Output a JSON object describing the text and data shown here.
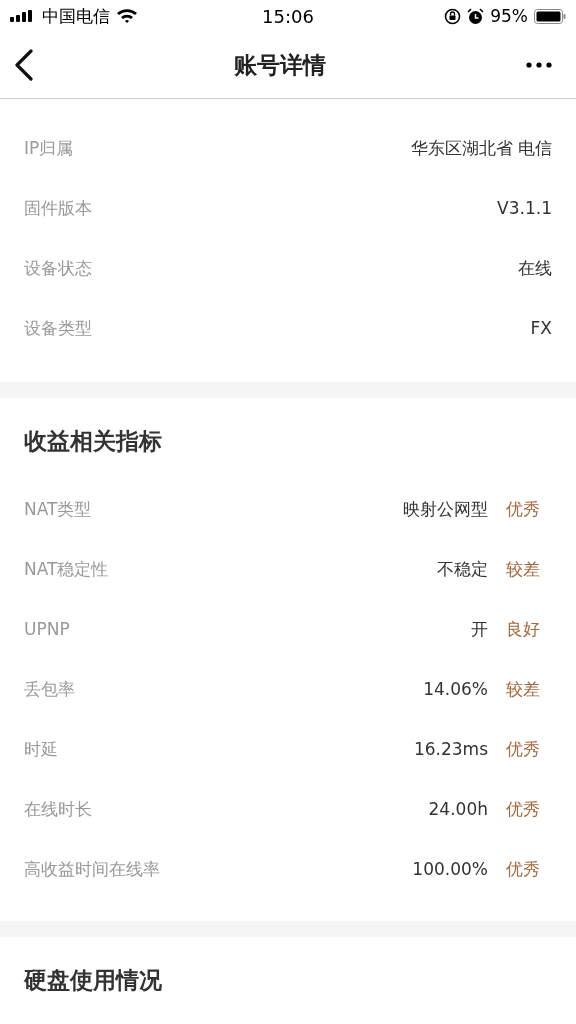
{
  "status_bar": {
    "carrier": "中国电信",
    "time": "15:06",
    "battery": "95%"
  },
  "nav": {
    "title": "账号详情"
  },
  "info": [
    {
      "label": "IP归属",
      "value": "华东区湖北省 电信"
    },
    {
      "label": "固件版本",
      "value": "V3.1.1"
    },
    {
      "label": "设备状态",
      "value": "在线"
    },
    {
      "label": "设备类型",
      "value": "FX"
    }
  ],
  "metrics": {
    "title": "收益相关指标",
    "rows": [
      {
        "label": "NAT类型",
        "value": "映射公网型",
        "rating": "优秀"
      },
      {
        "label": "NAT稳定性",
        "value": "不稳定",
        "rating": "较差"
      },
      {
        "label": "UPNP",
        "value": "开",
        "rating": "良好"
      },
      {
        "label": "丢包率",
        "value": "14.06%",
        "rating": "较差"
      },
      {
        "label": "时延",
        "value": "16.23ms",
        "rating": "优秀"
      },
      {
        "label": "在线时长",
        "value": "24.00h",
        "rating": "优秀"
      },
      {
        "label": "高收益时间在线率",
        "value": "100.00%",
        "rating": "优秀"
      }
    ]
  },
  "disk": {
    "title": "硬盘使用情况"
  }
}
